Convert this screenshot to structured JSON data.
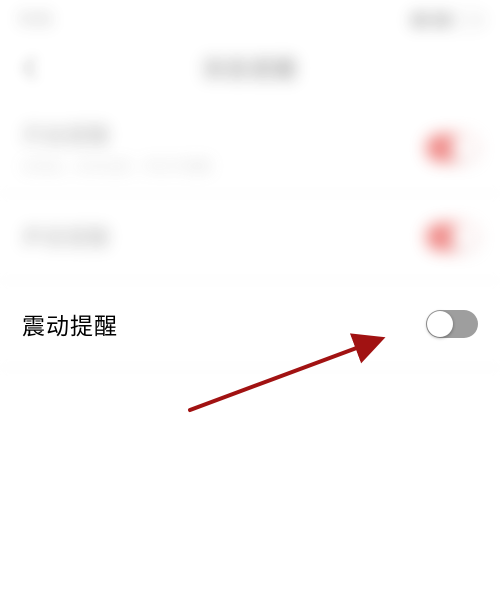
{
  "statusbar": {
    "time": "9:41"
  },
  "nav": {
    "title": "消息提醒"
  },
  "rows": [
    {
      "title": "开启提醒",
      "subtitle": "关闭后，任何全部、评论不提醒",
      "state": "on"
    },
    {
      "title": "声音提醒",
      "subtitle": "",
      "state": "on"
    },
    {
      "title": "震动提醒",
      "subtitle": "",
      "state": "off"
    }
  ]
}
